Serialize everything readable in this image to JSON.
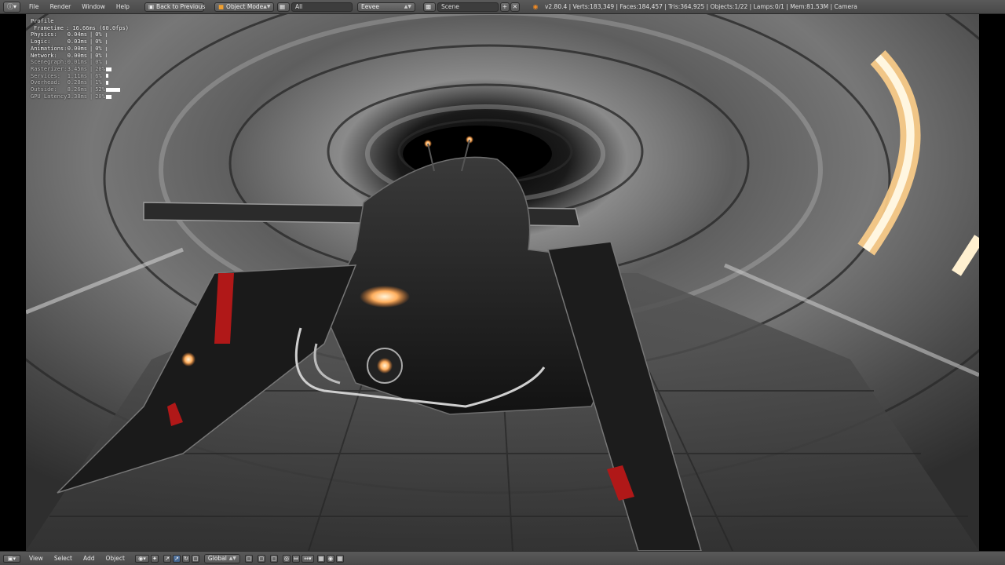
{
  "header": {
    "menus": [
      "File",
      "Render",
      "Window",
      "Help"
    ],
    "back_button": "Back to Previous",
    "mode": "Object Mode",
    "layer_field": "All",
    "engine": "Eevee",
    "scene": "Scene",
    "stats": "v2.80.4 | Verts:183,349 | Faces:184,457 | Tris:364,925 | Objects:1/22 | Lamps:0/1 | Mem:81.53M | Camera"
  },
  "profile": {
    "title": "Profile",
    "rows": [
      {
        "name": "Frametime",
        "time": ": 16.66ms (60.0fps)",
        "pct": "",
        "bar": 0
      },
      {
        "name": "Physics:",
        "time": "0.04ms",
        "pct": "0%",
        "bar": 0
      },
      {
        "name": "Logic:",
        "time": "0.03ms",
        "pct": "0%",
        "bar": 0
      },
      {
        "name": "Animations:",
        "time": "0.00ms",
        "pct": "0%",
        "bar": 0
      },
      {
        "name": "Network:",
        "time": "0.00ms",
        "pct": "0%",
        "bar": 0
      },
      {
        "name": "Scenegraph:",
        "time": "0.01ms",
        "pct": "0%",
        "bar": 0
      },
      {
        "name": "Rasterizer:",
        "time": "3.45ms",
        "pct": "20%",
        "bar": 20
      },
      {
        "name": "Services:",
        "time": "1.11ms",
        "pct": "6%",
        "bar": 6
      },
      {
        "name": "Overhead:",
        "time": "0.28ms",
        "pct": "1%",
        "bar": 1
      },
      {
        "name": "Outside:",
        "time": "8.26ms",
        "pct": "52%",
        "bar": 52
      },
      {
        "name": "GPU Latency:",
        "time": "3.38ms",
        "pct": "20%",
        "bar": 20
      }
    ]
  },
  "footer": {
    "menus": [
      "View",
      "Select",
      "Add",
      "Object"
    ],
    "orientation": "Global"
  }
}
